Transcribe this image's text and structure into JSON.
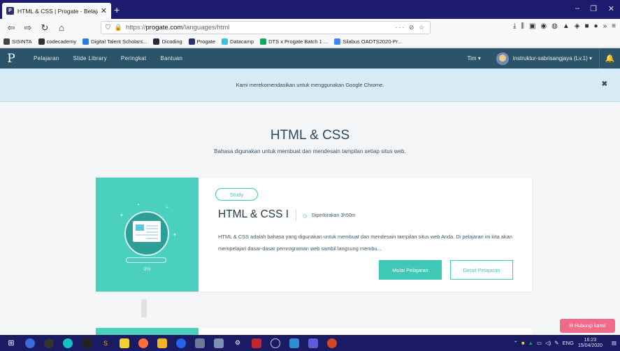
{
  "browser": {
    "tab_title": "HTML & CSS | Progate - Belajar",
    "tab_favicon": "P",
    "tab_close": "✕",
    "new_tab": "+",
    "url_prefix": "https://",
    "url_host": "progate.com",
    "url_path": "/languages/html",
    "url_actions": "··· ⊘ ☆",
    "win_min": "–",
    "win_max": "❐",
    "win_close": "✕"
  },
  "bookmarks": [
    {
      "label": "SISINTA",
      "color": "#444444"
    },
    {
      "label": "codecademy",
      "color": "#333333"
    },
    {
      "label": "Digital Talent Scholars...",
      "color": "#2a7bd4"
    },
    {
      "label": "Dicoding",
      "color": "#222c3c"
    },
    {
      "label": "Progate",
      "color": "#2b2f6e"
    },
    {
      "label": "Datacamp",
      "color": "#3ac1e0"
    },
    {
      "label": "DTS x Progate Batch 1 ...",
      "color": "#1aa260"
    },
    {
      "label": "Silabus OADTS2020-Pr...",
      "color": "#4285f4"
    }
  ],
  "header": {
    "logo": "P",
    "menu": [
      "Pelajaran",
      "Slide Library",
      "Peringkat",
      "Bantuan"
    ],
    "team": "Tim ▾",
    "username": "instruktur-sabrisangjaya (Lv.1) ▾"
  },
  "notice": {
    "text": "Kami merekomendasikan untuk menggunakan Google Chrome.",
    "close": "✖"
  },
  "main": {
    "title": "HTML & CSS",
    "subtitle": "Bahasa digunakan untuk membuat dan mendesain tampilan setiap situs web."
  },
  "course": {
    "badge": "Study",
    "title": "HTML & CSS I",
    "estimate": "Diperkirakan 3h50m",
    "description": "HTML & CSS adalah bahasa yang digunakan untuk membuat dan mendesain tampilan situs web Anda. Di pelajaran ini kita akan mempelajari dasar-dasar pemrograman web sambil langsung membu...",
    "progress_label": "0%",
    "progress_fraction": 0.0,
    "start_button": "Mulai Pelajaran",
    "detail_button": "Detail Pelajaran",
    "accent_color": "#3ec9b6"
  },
  "contact_button": "✉ Hubungi kami!",
  "taskbar": {
    "lang": "ENG",
    "time": "16:23",
    "date": "15/04/2020"
  }
}
